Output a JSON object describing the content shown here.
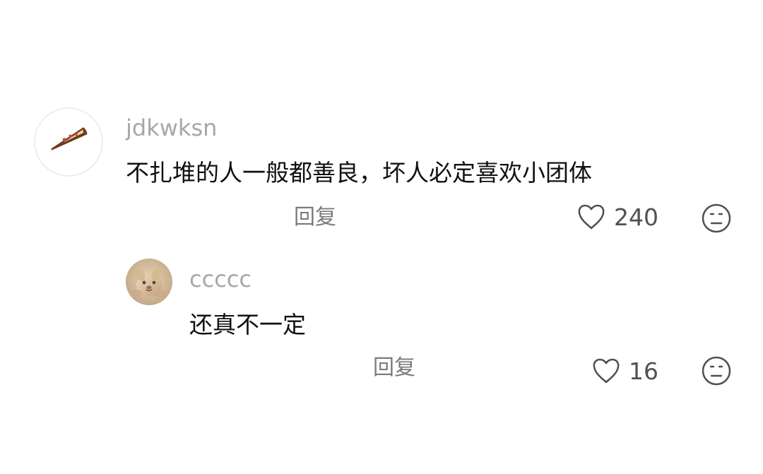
{
  "comments": [
    {
      "username": "jdkwksn",
      "text": "不扎堆的人一般都善良，坏人必定喜欢小团体",
      "reply_label": "回复",
      "like_count": "240"
    },
    {
      "username": "ccccc",
      "text": "还真不一定",
      "reply_label": "回复",
      "like_count": "16"
    }
  ],
  "icons": {
    "main_avatar": "pizza-icon",
    "reply_avatar": "cat-avatar-icon",
    "like": "heart-outline-icon",
    "dislike": "neutral-face-icon"
  },
  "colors": {
    "background": "#ffffff",
    "username": "#a7a7a7",
    "comment_text": "#111111",
    "secondary_text": "#7a7a7a",
    "icon_stroke": "#4f4f4f"
  }
}
